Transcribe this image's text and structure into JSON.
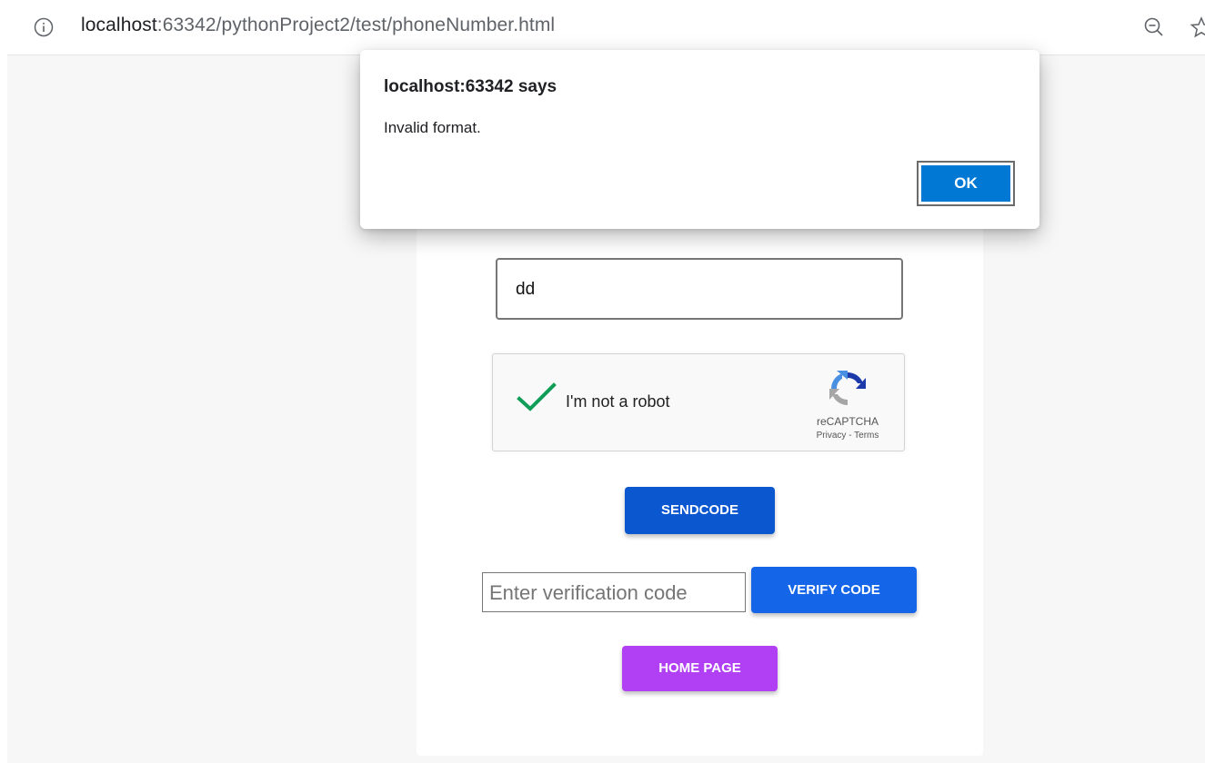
{
  "browser": {
    "url_host": "localhost",
    "url_rest": ":63342/pythonProject2/test/phoneNumber.html",
    "icons": {
      "info": "info-circle-icon",
      "zoom": "zoom-out-icon",
      "bookmark": "star-icon"
    }
  },
  "form": {
    "phone_value": "dd",
    "recaptcha": {
      "label": "I'm not a robot",
      "brand": "reCAPTCHA",
      "links": "Privacy - Terms",
      "checked": true
    },
    "send_button": "SENDCODE",
    "code_placeholder": "Enter verification code",
    "verify_button": "VERIFY CODE",
    "home_button": "HOME PAGE"
  },
  "dialog": {
    "title": "localhost:63342 says",
    "message": "Invalid format.",
    "ok_label": "OK"
  },
  "colors": {
    "send_button": "#0b57d0",
    "verify_button": "#1565e8",
    "home_button": "#b140f5",
    "ok_button": "#0078d4",
    "check_mark": "#0f9d58"
  }
}
